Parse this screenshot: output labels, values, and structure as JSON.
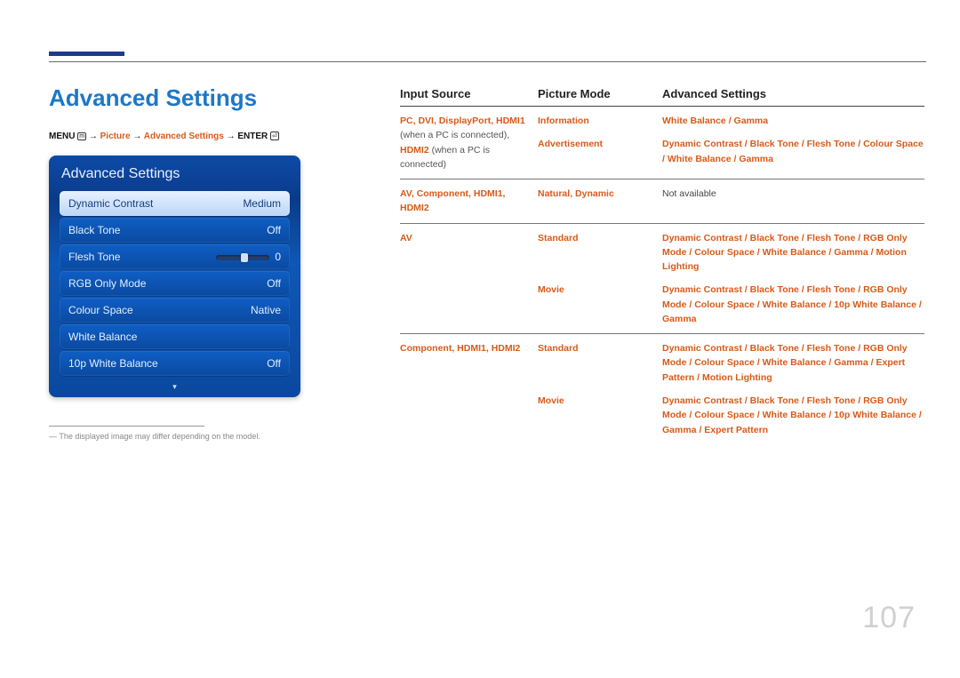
{
  "page": {
    "number": "107"
  },
  "title": "Advanced Settings",
  "breadcrumb": {
    "menu": "MENU",
    "arrow": "→",
    "p1": "Picture",
    "p2": "Advanced Settings",
    "enter": "ENTER"
  },
  "osd": {
    "title": "Advanced Settings",
    "rows": [
      {
        "label": "Dynamic Contrast",
        "value": "Medium",
        "selected": true
      },
      {
        "label": "Black Tone",
        "value": "Off"
      },
      {
        "label": "Flesh Tone",
        "value": "0",
        "slider": true
      },
      {
        "label": "RGB Only Mode",
        "value": "Off"
      },
      {
        "label": "Colour Space",
        "value": "Native"
      },
      {
        "label": "White Balance",
        "value": ""
      },
      {
        "label": "10p White Balance",
        "value": "Off"
      }
    ]
  },
  "footnote": "The displayed image may differ depending on the model.",
  "table": {
    "headers": {
      "c1": "Input Source",
      "c2": "Picture Mode",
      "c3": "Advanced Settings"
    },
    "rows": [
      {
        "c1": [
          {
            "t": "PC",
            "hl": true
          },
          {
            "t": ", "
          },
          {
            "t": "DVI",
            "hl": true
          },
          {
            "t": ", "
          },
          {
            "t": "DisplayPort",
            "hl": true
          },
          {
            "t": ", "
          },
          {
            "t": "HDMI1",
            "hl": true
          },
          {
            "t": " (when a PC is connected), ",
            "plain": true
          },
          {
            "t": "HDMI2",
            "hl": true
          },
          {
            "t": " (when a PC is connected)",
            "plain": true
          }
        ],
        "sub": [
          {
            "c2": [
              {
                "t": "Information",
                "hl": true
              }
            ],
            "c3": [
              {
                "t": "White Balance",
                "hl": true
              },
              {
                "t": " / "
              },
              {
                "t": "Gamma",
                "hl": true
              }
            ]
          },
          {
            "c2": [
              {
                "t": "Advertisement",
                "hl": true
              }
            ],
            "c3": [
              {
                "t": "Dynamic Contrast",
                "hl": true
              },
              {
                "t": " / "
              },
              {
                "t": "Black Tone",
                "hl": true
              },
              {
                "t": " / "
              },
              {
                "t": "Flesh Tone",
                "hl": true
              },
              {
                "t": " / "
              },
              {
                "t": "Colour Space",
                "hl": true
              },
              {
                "t": " / "
              },
              {
                "t": "White Balance",
                "hl": true
              },
              {
                "t": " / "
              },
              {
                "t": "Gamma",
                "hl": true
              }
            ]
          }
        ]
      },
      {
        "c1": [
          {
            "t": "AV",
            "hl": true
          },
          {
            "t": ", "
          },
          {
            "t": "Component",
            "hl": true
          },
          {
            "t": ", "
          },
          {
            "t": "HDMI1",
            "hl": true
          },
          {
            "t": ", "
          },
          {
            "t": "HDMI2",
            "hl": true
          }
        ],
        "sub": [
          {
            "c2": [
              {
                "t": "Natural",
                "hl": true
              },
              {
                "t": ", "
              },
              {
                "t": "Dynamic",
                "hl": true
              }
            ],
            "c3": [
              {
                "t": "Not available",
                "na": true
              }
            ]
          }
        ]
      },
      {
        "c1": [
          {
            "t": "AV",
            "hl": true
          }
        ],
        "sub": [
          {
            "c2": [
              {
                "t": "Standard",
                "hl": true
              }
            ],
            "c3": [
              {
                "t": "Dynamic Contrast",
                "hl": true
              },
              {
                "t": " / "
              },
              {
                "t": "Black Tone",
                "hl": true
              },
              {
                "t": " / "
              },
              {
                "t": "Flesh Tone",
                "hl": true
              },
              {
                "t": " / "
              },
              {
                "t": "RGB Only Mode",
                "hl": true
              },
              {
                "t": " / "
              },
              {
                "t": "Colour Space",
                "hl": true
              },
              {
                "t": " / "
              },
              {
                "t": "White Balance",
                "hl": true
              },
              {
                "t": " / "
              },
              {
                "t": "Gamma",
                "hl": true
              },
              {
                "t": " / "
              },
              {
                "t": "Motion Lighting",
                "hl": true
              }
            ]
          },
          {
            "c2": [
              {
                "t": "Movie",
                "hl": true
              }
            ],
            "c3": [
              {
                "t": "Dynamic Contrast",
                "hl": true
              },
              {
                "t": " / "
              },
              {
                "t": "Black Tone",
                "hl": true
              },
              {
                "t": " / "
              },
              {
                "t": "Flesh Tone",
                "hl": true
              },
              {
                "t": " / "
              },
              {
                "t": "RGB Only Mode",
                "hl": true
              },
              {
                "t": " / "
              },
              {
                "t": "Colour Space",
                "hl": true
              },
              {
                "t": " / "
              },
              {
                "t": "White Balance",
                "hl": true
              },
              {
                "t": " / "
              },
              {
                "t": "10p White Balance",
                "hl": true
              },
              {
                "t": " / "
              },
              {
                "t": "Gamma",
                "hl": true
              }
            ]
          }
        ]
      },
      {
        "c1": [
          {
            "t": "Component",
            "hl": true
          },
          {
            "t": ", "
          },
          {
            "t": "HDMI1",
            "hl": true
          },
          {
            "t": ", "
          },
          {
            "t": "HDMI2",
            "hl": true
          }
        ],
        "sub": [
          {
            "c2": [
              {
                "t": "Standard",
                "hl": true
              }
            ],
            "c3": [
              {
                "t": "Dynamic Contrast",
                "hl": true
              },
              {
                "t": " / "
              },
              {
                "t": "Black Tone",
                "hl": true
              },
              {
                "t": " / "
              },
              {
                "t": "Flesh Tone",
                "hl": true
              },
              {
                "t": " / "
              },
              {
                "t": "RGB Only Mode",
                "hl": true
              },
              {
                "t": " / "
              },
              {
                "t": "Colour Space",
                "hl": true
              },
              {
                "t": " / "
              },
              {
                "t": "White Balance",
                "hl": true
              },
              {
                "t": " / "
              },
              {
                "t": "Gamma",
                "hl": true
              },
              {
                "t": " / "
              },
              {
                "t": "Expert Pattern",
                "hl": true
              },
              {
                "t": " / "
              },
              {
                "t": "Motion Lighting",
                "hl": true
              }
            ]
          },
          {
            "c2": [
              {
                "t": "Movie",
                "hl": true
              }
            ],
            "c3": [
              {
                "t": "Dynamic Contrast",
                "hl": true
              },
              {
                "t": " / "
              },
              {
                "t": "Black Tone",
                "hl": true
              },
              {
                "t": " / "
              },
              {
                "t": "Flesh Tone",
                "hl": true
              },
              {
                "t": " / "
              },
              {
                "t": "RGB Only Mode",
                "hl": true
              },
              {
                "t": " / "
              },
              {
                "t": "Colour Space",
                "hl": true
              },
              {
                "t": " / "
              },
              {
                "t": "White Balance",
                "hl": true
              },
              {
                "t": " / "
              },
              {
                "t": "10p White Balance",
                "hl": true
              },
              {
                "t": " / "
              },
              {
                "t": "Gamma",
                "hl": true
              },
              {
                "t": " / "
              },
              {
                "t": "Expert Pattern",
                "hl": true
              }
            ]
          }
        ]
      }
    ]
  }
}
